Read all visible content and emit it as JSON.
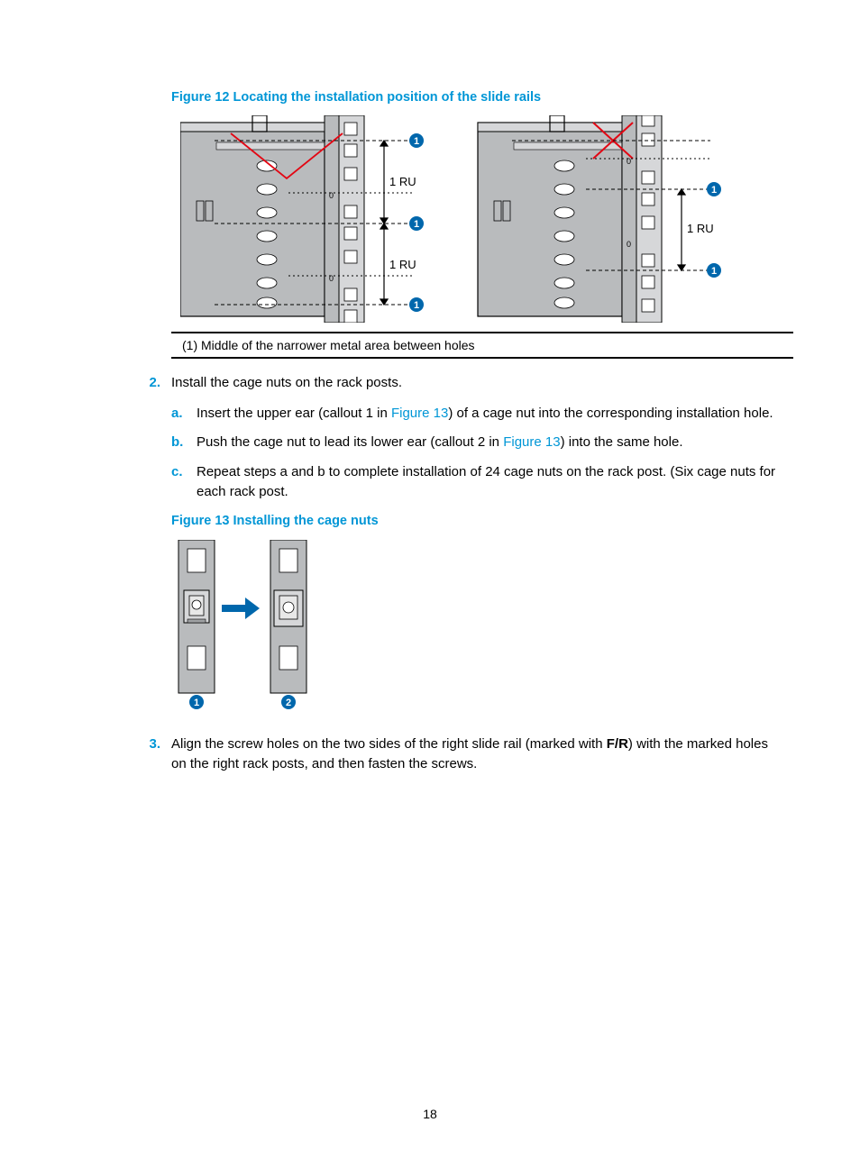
{
  "figure12": {
    "caption": "Figure 12 Locating the installation position of the slide rails",
    "ru_label_1": "1 RU",
    "ru_label_2": "1 RU",
    "ru_label_3": "1 RU",
    "legend": "(1) Middle of the narrower metal area between holes"
  },
  "steps": {
    "s2_num": "2.",
    "s2_text": "Install the cage nuts on the rack posts.",
    "s2a_letter": "a.",
    "s2a_pre": "Insert the upper ear (callout 1 in ",
    "s2a_link": "Figure 13",
    "s2a_post": ") of a cage nut into the corresponding installation hole.",
    "s2b_letter": "b.",
    "s2b_pre": "Push the cage nut to lead its lower ear (callout 2 in ",
    "s2b_link": "Figure 13",
    "s2b_post": ") into the same hole.",
    "s2c_letter": "c.",
    "s2c_text": "Repeat steps a and b to complete installation of 24 cage nuts on the rack post. (Six cage nuts for each rack post.",
    "s3_num": "3.",
    "s3_pre": "Align the screw holes on the two sides of the right slide rail (marked with ",
    "s3_bold": "F/R",
    "s3_post": ") with the marked holes on the right rack posts, and then fasten the screws."
  },
  "figure13": {
    "caption": "Figure 13 Installing the cage nuts"
  },
  "page_number": "18"
}
